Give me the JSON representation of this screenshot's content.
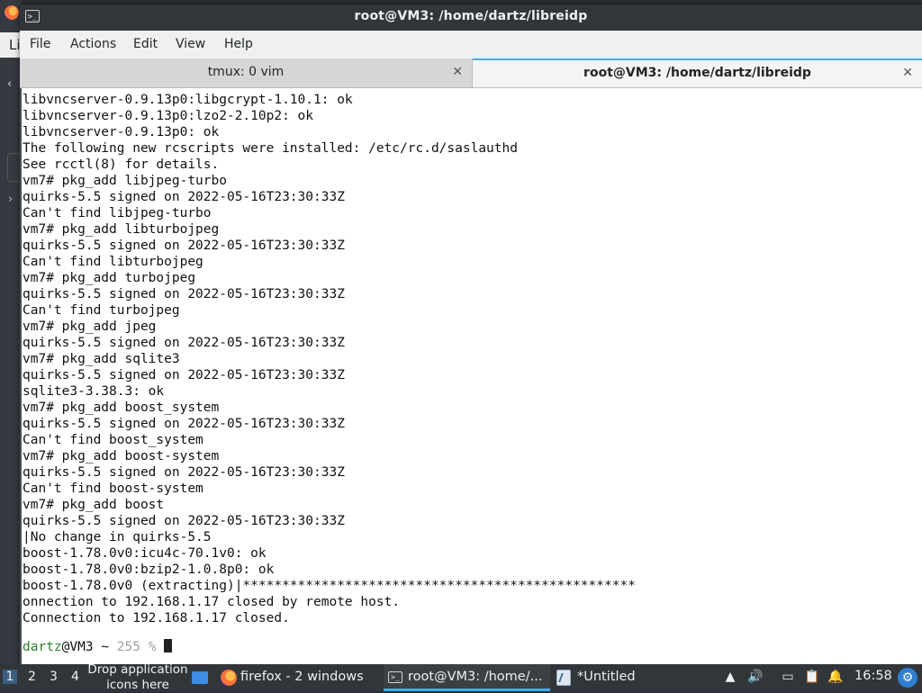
{
  "desktop": {
    "left_tab_label": "Li"
  },
  "window": {
    "title": "root@VM3: /home/dartz/libreidp",
    "icon_glyph": ">_",
    "menu": [
      "File",
      "Actions",
      "Edit",
      "View",
      "Help"
    ],
    "tabs": [
      {
        "label": "tmux: 0 vim",
        "active": false,
        "close": "✕"
      },
      {
        "label": "root@VM3: /home/dartz/libreidp",
        "active": true,
        "close": "✕"
      }
    ]
  },
  "terminal": {
    "lines": [
      "libvncserver-0.9.13p0:libgcrypt-1.10.1: ok",
      "libvncserver-0.9.13p0:lzo2-2.10p2: ok",
      "libvncserver-0.9.13p0: ok",
      "The following new rcscripts were installed: /etc/rc.d/saslauthd",
      "See rcctl(8) for details.",
      "vm7# pkg_add libjpeg-turbo",
      "quirks-5.5 signed on 2022-05-16T23:30:33Z",
      "Can't find libjpeg-turbo",
      "vm7# pkg_add libturbojpeg",
      "quirks-5.5 signed on 2022-05-16T23:30:33Z",
      "Can't find libturbojpeg",
      "vm7# pkg_add turbojpeg",
      "quirks-5.5 signed on 2022-05-16T23:30:33Z",
      "Can't find turbojpeg",
      "vm7# pkg_add jpeg",
      "quirks-5.5 signed on 2022-05-16T23:30:33Z",
      "vm7# pkg_add sqlite3",
      "quirks-5.5 signed on 2022-05-16T23:30:33Z",
      "sqlite3-3.38.3: ok",
      "vm7# pkg_add boost_system",
      "quirks-5.5 signed on 2022-05-16T23:30:33Z",
      "Can't find boost_system",
      "vm7# pkg_add boost-system",
      "quirks-5.5 signed on 2022-05-16T23:30:33Z",
      "Can't find boost-system",
      "vm7# pkg_add boost",
      "quirks-5.5 signed on 2022-05-16T23:30:33Z",
      "|No change in quirks-5.5",
      "boost-1.78.0v0:icu4c-70.1v0: ok",
      "boost-1.78.0v0:bzip2-1.0.8p0: ok",
      "boost-1.78.0v0 (extracting)|**************************************************",
      "onnection to 192.168.1.17 closed by remote host.",
      "Connection to 192.168.1.17 closed."
    ],
    "prompt": {
      "user": "dartz",
      "host": "@VM3",
      "cwd": " ~ ",
      "status": "255 % "
    }
  },
  "taskbar": {
    "workspaces": [
      "1",
      "2",
      "3",
      "4"
    ],
    "drop_hint": "Drop application icons here",
    "tasks": [
      {
        "label": "firefox - 2 windows",
        "icon": "firefox-icon"
      },
      {
        "label": "root@VM3: /home/...",
        "icon": "terminal-icon",
        "active": true
      },
      {
        "label": "*Untitled",
        "icon": "text-editor-icon"
      }
    ],
    "clock": "16:58",
    "accent": "#3daee9"
  }
}
